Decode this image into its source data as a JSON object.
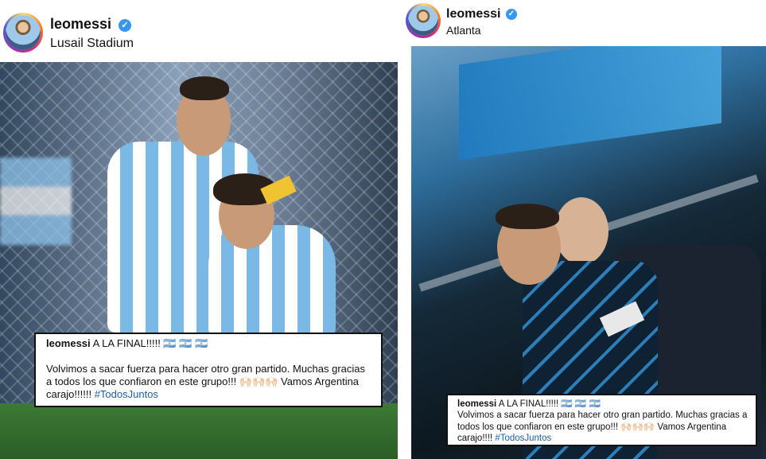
{
  "posts": [
    {
      "username": "leomessi",
      "location": "Lusail Stadium",
      "caption": {
        "username": "leomessi",
        "first_line": "A LA FINAL!!!!! 🇦🇷 🇦🇷 🇦🇷",
        "body": "Volvimos a sacar fuerza para hacer otro gran partido. Muchas gracias a todos los que confiaron en este grupo!!! 🙌🏻🙌🏻🙌🏻 Vamos Argentina carajo!!!!!!",
        "hashtag": "#TodosJuntos"
      }
    },
    {
      "username": "leomessi",
      "location": "Atlanta",
      "caption": {
        "username": "leomessi",
        "first_line": "A LA FINAL!!!!! 🇦🇷 🇦🇷 🇦🇷",
        "body": "Volvimos a sacar fuerza para hacer otro gran partido. Muchas gracias a todos los que confiaron en este grupo!!! 🙌🏻🙌🏻🙌🏻 Vamos Argentina carajo!!!!",
        "hashtag": "#TodosJuntos"
      }
    }
  ]
}
